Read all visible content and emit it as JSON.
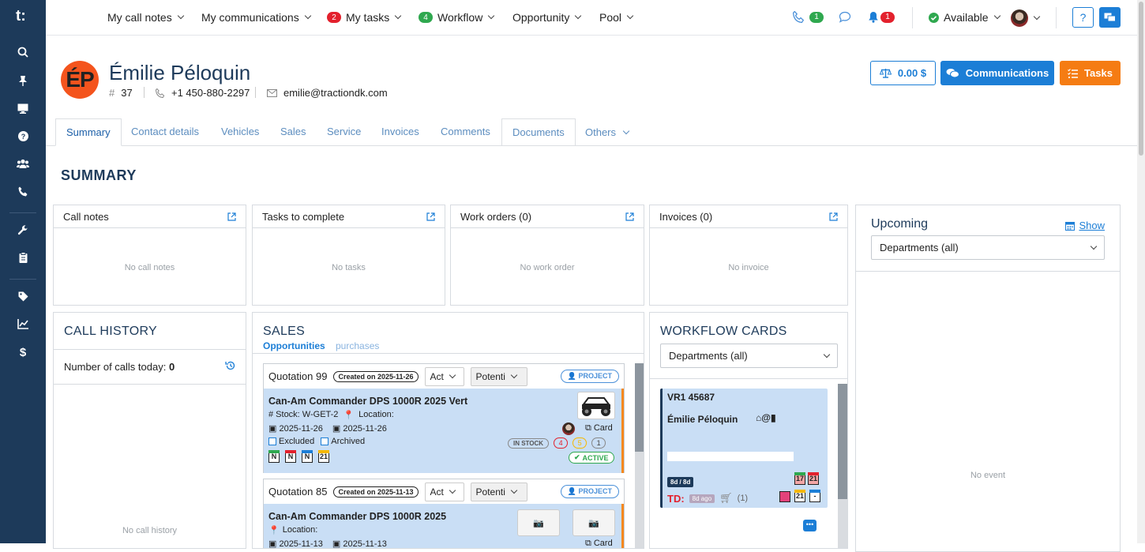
{
  "topnav": {
    "call_notes": "My call notes",
    "communications": "My communications",
    "tasks": "My tasks",
    "tasks_count": "2",
    "workflow": "Workflow",
    "workflow_count": "4",
    "opportunity": "Opportunity",
    "pool": "Pool",
    "phone_count": "1",
    "notif_count": "1",
    "status": "Available",
    "help": "?"
  },
  "client": {
    "initials": "ÉP",
    "name": "Émilie Péloquin",
    "id": "37",
    "phone": "+1 450-880-2297",
    "email": "emilie@tractiondk.com"
  },
  "actions": {
    "balance": "0.00 $",
    "communications": "Communications",
    "tasks": "Tasks"
  },
  "tabs": [
    "Summary",
    "Contact details",
    "Vehicles",
    "Sales",
    "Service",
    "Invoices",
    "Comments",
    "Documents",
    "Others"
  ],
  "summary_title": "SUMMARY",
  "cards": {
    "call_notes": {
      "title": "Call notes",
      "empty": "No call notes"
    },
    "tasks": {
      "title": "Tasks to complete",
      "empty": "No tasks"
    },
    "work_orders": {
      "title": "Work orders (0)",
      "empty": "No work order"
    },
    "invoices": {
      "title": "Invoices (0)",
      "empty": "No invoice"
    }
  },
  "upcoming": {
    "title": "Upcoming",
    "show": "Show",
    "dept": "Departments (all)",
    "empty": "No event"
  },
  "call_history": {
    "title": "CALL HISTORY",
    "calls_today_label": "Number of calls today:",
    "calls_today": "0",
    "empty": "No call history"
  },
  "sales": {
    "title": "SALES",
    "tab_opps": "Opportunities",
    "tab_purch": "purchases",
    "q1": {
      "title": "Quotation 99",
      "created": "Created on 2025-11-26",
      "act": "Act",
      "potenti": "Potenti",
      "project": "PROJECT",
      "vehicle": "Can-Am Commander DPS 1000R 2025 Vert",
      "stock": "# Stock: W-GET-2",
      "location": "Location:",
      "date1": "2025-11-26",
      "date2": "2025-11-26",
      "excluded": "Excluded",
      "archived": "Archived",
      "card": "Card",
      "in_stock": "IN STOCK",
      "c4": "4",
      "c5": "5",
      "c1": "1",
      "active": "ACTIVE",
      "cal": [
        "N",
        "N",
        "N",
        "21"
      ]
    },
    "q2": {
      "title": "Quotation 85",
      "created": "Created on 2025-11-13",
      "act": "Act",
      "potenti": "Potenti",
      "project": "PROJECT",
      "vehicle": "Can-Am Commander DPS 1000R 2025",
      "location": "Location:",
      "date1": "2025-11-13",
      "date2": "2025-11-13",
      "card": "Card"
    }
  },
  "workflow": {
    "title": "WORKFLOW CARDS",
    "dept": "Departments (all)",
    "card_title": "VR1 45687",
    "card_name": "Émilie Péloquin",
    "days": "8d / 8d",
    "td": "TD:",
    "ago": "8d ago",
    "cart_count": "(1)",
    "cal": [
      "17",
      "21",
      "21",
      "-"
    ]
  }
}
